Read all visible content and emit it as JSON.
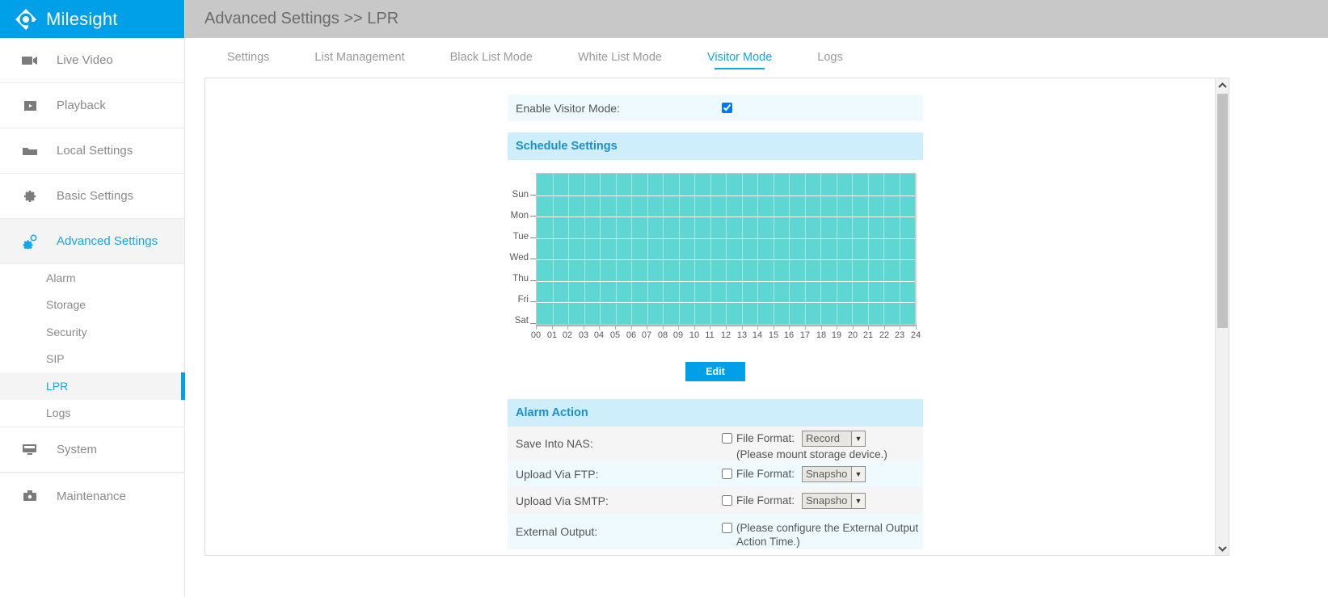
{
  "brand": {
    "name": "Milesight",
    "logo_icon": "milesight-diamond-logo"
  },
  "sidebar": {
    "items": [
      {
        "label": "Live Video",
        "icon": "video-camera-icon",
        "active": false
      },
      {
        "label": "Playback",
        "icon": "play-box-icon",
        "active": false
      },
      {
        "label": "Local Settings",
        "icon": "folder-icon",
        "active": false
      },
      {
        "label": "Basic Settings",
        "icon": "gear-icon",
        "active": false
      },
      {
        "label": "Advanced Settings",
        "icon": "gears-icon",
        "active": true
      },
      {
        "label": "System",
        "icon": "monitor-icon",
        "active": false
      },
      {
        "label": "Maintenance",
        "icon": "toolbox-icon",
        "active": false
      }
    ],
    "sub_items": [
      {
        "label": "Alarm",
        "active": false
      },
      {
        "label": "Storage",
        "active": false
      },
      {
        "label": "Security",
        "active": false
      },
      {
        "label": "SIP",
        "active": false
      },
      {
        "label": "LPR",
        "active": true
      },
      {
        "label": "Logs",
        "active": false
      }
    ]
  },
  "header": {
    "breadcrumb": "Advanced Settings >> LPR"
  },
  "tabs": [
    {
      "label": "Settings",
      "active": false
    },
    {
      "label": "List Management",
      "active": false
    },
    {
      "label": "Black List Mode",
      "active": false
    },
    {
      "label": "White List Mode",
      "active": false
    },
    {
      "label": "Visitor Mode",
      "active": true
    },
    {
      "label": "Logs",
      "active": false
    }
  ],
  "visitor_mode": {
    "enable_label": "Enable Visitor Mode:",
    "enable_checked": true,
    "schedule_section_title": "Schedule Settings",
    "edit_button": "Edit",
    "alarm_section_title": "Alarm Action",
    "rows": [
      {
        "label": "Save Into NAS:",
        "checked": false,
        "file_format_label": "File Format:",
        "file_format_value": "Record",
        "note": "(Please mount storage device.)"
      },
      {
        "label": "Upload Via FTP:",
        "checked": false,
        "file_format_label": "File Format:",
        "file_format_value": "Snapsho",
        "note": ""
      },
      {
        "label": "Upload Via SMTP:",
        "checked": false,
        "file_format_label": "File Format:",
        "file_format_value": "Snapsho",
        "note": ""
      },
      {
        "label": "External Output:",
        "checked": false,
        "file_format_label": "",
        "file_format_value": "",
        "note": "(Please configure the External Output Action Time.)"
      }
    ]
  },
  "chart_data": {
    "type": "heatmap",
    "title": "Schedule Settings",
    "xlabel": "",
    "ylabel": "",
    "categories": [
      "Sun",
      "Mon",
      "Tue",
      "Wed",
      "Thu",
      "Fri",
      "Sat"
    ],
    "x_ticks": [
      "00",
      "01",
      "02",
      "03",
      "04",
      "05",
      "06",
      "07",
      "08",
      "09",
      "10",
      "11",
      "12",
      "13",
      "14",
      "15",
      "16",
      "17",
      "18",
      "19",
      "20",
      "21",
      "22",
      "23",
      "24"
    ],
    "xlim": [
      0,
      24
    ],
    "grid": true,
    "legend": "none",
    "selected_color": "#5ed6d2",
    "unselected_color": "#ffffff",
    "series": [
      {
        "name": "Sun",
        "values": [
          1,
          1,
          1,
          1,
          1,
          1,
          1,
          1,
          1,
          1,
          1,
          1,
          1,
          1,
          1,
          1,
          1,
          1,
          1,
          1,
          1,
          1,
          1,
          1
        ]
      },
      {
        "name": "Mon",
        "values": [
          1,
          1,
          1,
          1,
          1,
          1,
          1,
          1,
          1,
          1,
          1,
          1,
          1,
          1,
          1,
          1,
          1,
          1,
          1,
          1,
          1,
          1,
          1,
          1
        ]
      },
      {
        "name": "Tue",
        "values": [
          1,
          1,
          1,
          1,
          1,
          1,
          1,
          1,
          1,
          1,
          1,
          1,
          1,
          1,
          1,
          1,
          1,
          1,
          1,
          1,
          1,
          1,
          1,
          1
        ]
      },
      {
        "name": "Wed",
        "values": [
          1,
          1,
          1,
          1,
          1,
          1,
          1,
          1,
          1,
          1,
          1,
          1,
          1,
          1,
          1,
          1,
          1,
          1,
          1,
          1,
          1,
          1,
          1,
          1
        ]
      },
      {
        "name": "Thu",
        "values": [
          1,
          1,
          1,
          1,
          1,
          1,
          1,
          1,
          1,
          1,
          1,
          1,
          1,
          1,
          1,
          1,
          1,
          1,
          1,
          1,
          1,
          1,
          1,
          1
        ]
      },
      {
        "name": "Fri",
        "values": [
          1,
          1,
          1,
          1,
          1,
          1,
          1,
          1,
          1,
          1,
          1,
          1,
          1,
          1,
          1,
          1,
          1,
          1,
          1,
          1,
          1,
          1,
          1,
          1
        ]
      },
      {
        "name": "Sat",
        "values": [
          1,
          1,
          1,
          1,
          1,
          1,
          1,
          1,
          1,
          1,
          1,
          1,
          1,
          1,
          1,
          1,
          1,
          1,
          1,
          1,
          1,
          1,
          1,
          1
        ]
      }
    ]
  },
  "colors": {
    "brand_blue": "#00a0e9",
    "accent_blue": "#13a7e8",
    "topbar_gray": "#c8c8c8",
    "schedule_teal": "#5ed6d2",
    "section_header_bg": "#cfeefb"
  },
  "scrollbar": {
    "up_icon": "chevron-up-icon",
    "down_icon": "chevron-down-icon"
  }
}
